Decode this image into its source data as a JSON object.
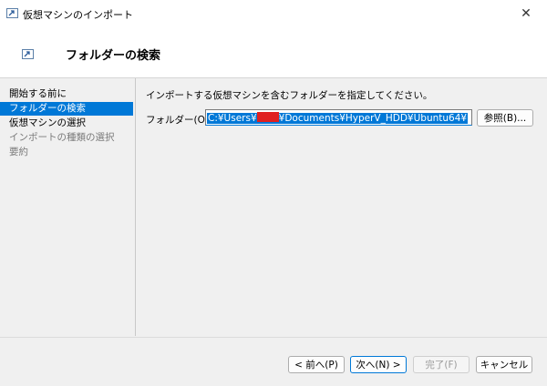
{
  "window": {
    "title": "仮想マシンのインポート"
  },
  "header": {
    "page_title": "フォルダーの検索"
  },
  "nav": {
    "items": [
      {
        "label": "開始する前に",
        "state": "normal"
      },
      {
        "label": "フォルダーの検索",
        "state": "active"
      },
      {
        "label": "仮想マシンの選択",
        "state": "normal"
      },
      {
        "label": "インポートの種類の選択",
        "state": "disabled"
      },
      {
        "label": "要約",
        "state": "disabled"
      }
    ]
  },
  "main": {
    "instruction": "インポートする仮想マシンを含むフォルダーを指定してください。",
    "folder_label": "フォルダー(O):",
    "folder_value_prefix": "C:¥Users¥",
    "folder_value_suffix": "¥Documents¥HyperV_HDD¥Ubuntu64¥",
    "browse_label": "参照(B)..."
  },
  "footer": {
    "prev_label": "< 前へ(P)",
    "next_label": "次へ(N) >",
    "finish_label": "完了(F)",
    "cancel_label": "キャンセル"
  },
  "colors": {
    "accent": "#0078d7",
    "redaction": "#e02020",
    "background": "#f0f0f0"
  },
  "icons": {
    "app": "import-arrow-icon",
    "close": "close-icon"
  }
}
